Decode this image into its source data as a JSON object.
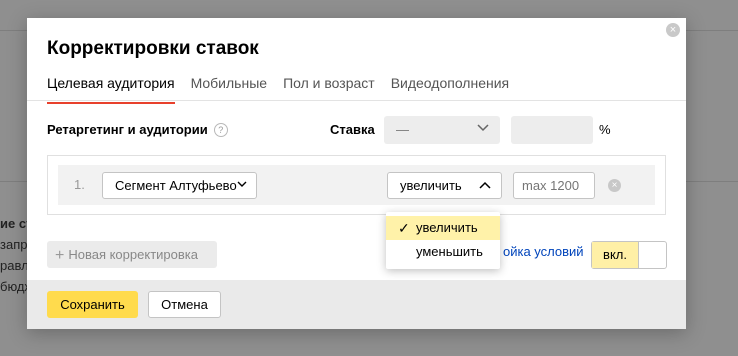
{
  "background": {
    "text_lines": [
      "ие ст",
      "запр",
      "равл",
      "бюдж"
    ]
  },
  "modal": {
    "title": "Корректировки ставок",
    "close_symbol": "×",
    "tabs": [
      {
        "label": "Целевая аудитория",
        "active": true
      },
      {
        "label": "Мобильные",
        "active": false
      },
      {
        "label": "Пол и возраст",
        "active": false
      },
      {
        "label": "Видеодополнения",
        "active": false
      }
    ],
    "retargeting_label": "Ретаргетинг и аудитории",
    "help_symbol": "?",
    "stavka": {
      "label": "Ставка",
      "select_value": "—",
      "input_value": "",
      "unit": "%"
    },
    "rule": {
      "number": "1.",
      "segment": "Сегмент Алтуфьево",
      "direction": "увеличить",
      "max_placeholder": "max 1200",
      "remove_symbol": "×"
    },
    "new_adjustment": {
      "plus": "+",
      "label": "Новая корректировка"
    },
    "conditions_link": "ойка условий",
    "toggle_label": "вкл.",
    "footer": {
      "save": "Сохранить",
      "cancel": "Отмена"
    },
    "dropdown": {
      "check_symbol": "✓",
      "options": [
        {
          "label": "увеличить",
          "selected": true
        },
        {
          "label": "уменьшить",
          "selected": false
        }
      ]
    }
  },
  "colors": {
    "overlay": "#8f8f8f",
    "accent_tab": "#e8402c",
    "primary_button": "#ffdb4d",
    "selected_option": "#fff2a9",
    "link": "#0044bb"
  }
}
